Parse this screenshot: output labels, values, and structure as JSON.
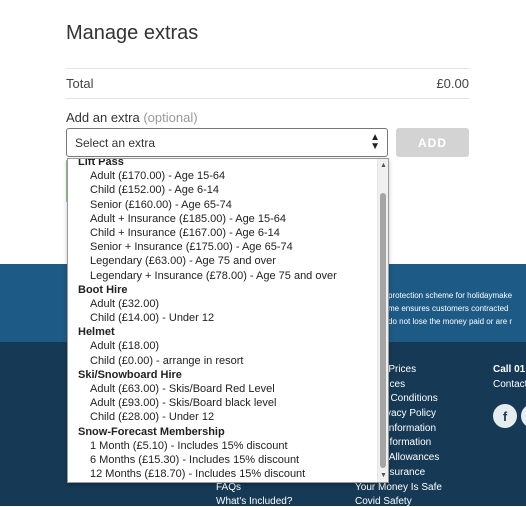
{
  "page": {
    "title": "Manage extras",
    "total_label": "Total",
    "total_value": "£0.00",
    "add_label": "Add an extra",
    "add_optional": "(optional)",
    "select_placeholder": "Select an extra",
    "add_button": "ADD"
  },
  "dropdown": {
    "groups": [
      {
        "label": "Lift Pass",
        "items": [
          "Adult (£170.00) - Age 15-64",
          "Child (£152.00) - Age 6-14",
          "Senior (£160.00) - Age 65-74",
          "Adult + Insurance (£185.00) - Age 15-64",
          "Child + Insurance (£167.00) - Age 6-14",
          "Senior + Insurance (£175.00) - Age 65-74",
          "Legendary (£63.00) - Age 75 and over",
          "Legendary + Insurance (£78.00) - Age 75 and over"
        ]
      },
      {
        "label": "Boot Hire",
        "items": [
          "Adult (£32.00)",
          "Child (£14.00) - Under 12"
        ]
      },
      {
        "label": "Helmet",
        "items": [
          "Adult (£18.00)",
          "Child (£0.00) - arrange in resort"
        ]
      },
      {
        "label": "Ski/Snowboard Hire",
        "items": [
          "Adult (£63.00) - Skis/Board Red Level",
          "Adult (£93.00) - Skis/Board black level",
          "Child (£28.00) - Under 12"
        ]
      },
      {
        "label": "Snow-Forecast Membership",
        "items": [
          "1 Month (£5.10) - Includes 15% discount",
          "6 Months (£15.30) - Includes 15% discount",
          "12 Months (£18.70) - Includes 15% discount"
        ]
      }
    ]
  },
  "footer": {
    "protection_lines": [
      "protection scheme for holidaymake",
      "me ensures customers contracted",
      "do not lose the money paid or are r"
    ],
    "links_col_left": [
      "FAQs",
      "What's Included?"
    ],
    "links_col_mid": [
      "e Prices",
      "rices",
      "& Conditions",
      "vacy Policy",
      "l Information",
      "nformation",
      "e Allowances",
      "nsurance",
      "Your Money Is Safe",
      "Covid Safety"
    ],
    "call": "Call 01",
    "contact": "Contact",
    "social_icons": [
      "facebook-icon",
      "twitter-icon"
    ]
  }
}
